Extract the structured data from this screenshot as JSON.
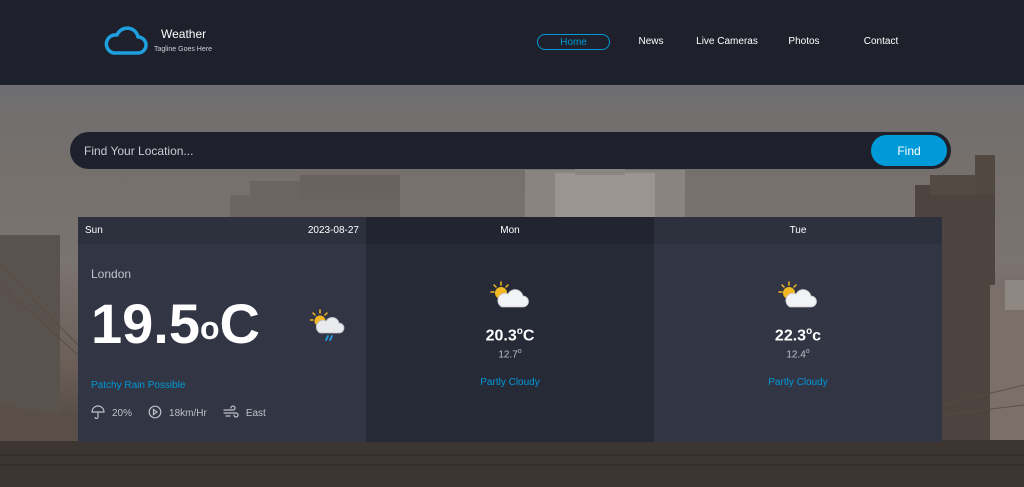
{
  "brand": {
    "title": "Weather",
    "tagline": "Tagline Goes Here",
    "accent": "#009ad8",
    "icon": "cloud-icon"
  },
  "nav": {
    "items": [
      {
        "label": "Home",
        "active": true
      },
      {
        "label": "News",
        "active": false
      },
      {
        "label": "Live Cameras",
        "active": false
      },
      {
        "label": "Photos",
        "active": false
      },
      {
        "label": "Contact",
        "active": false
      }
    ]
  },
  "search": {
    "placeholder": "Find Your Location...",
    "button_label": "Find"
  },
  "today": {
    "day": "Sun",
    "date": "2023-08-27",
    "location": "London",
    "temp": "19.5",
    "unit_degree": "o",
    "unit_letter": "C",
    "condition": "Patchy Rain Possible",
    "icon": "sun-cloud-rain-icon",
    "humidity": "20%",
    "wind_speed": "18km/Hr",
    "wind_direction": "East"
  },
  "forecast": [
    {
      "day": "Mon",
      "hi": "20.3",
      "hi_unit": "C",
      "lo": "12.7",
      "degree": "o",
      "condition": "Partly Cloudy",
      "icon": "partly-cloudy-icon"
    },
    {
      "day": "Tue",
      "hi": "22.3",
      "hi_unit": "c",
      "lo": "12.4",
      "degree": "o",
      "condition": "Partly Cloudy",
      "icon": "partly-cloudy-icon"
    }
  ]
}
